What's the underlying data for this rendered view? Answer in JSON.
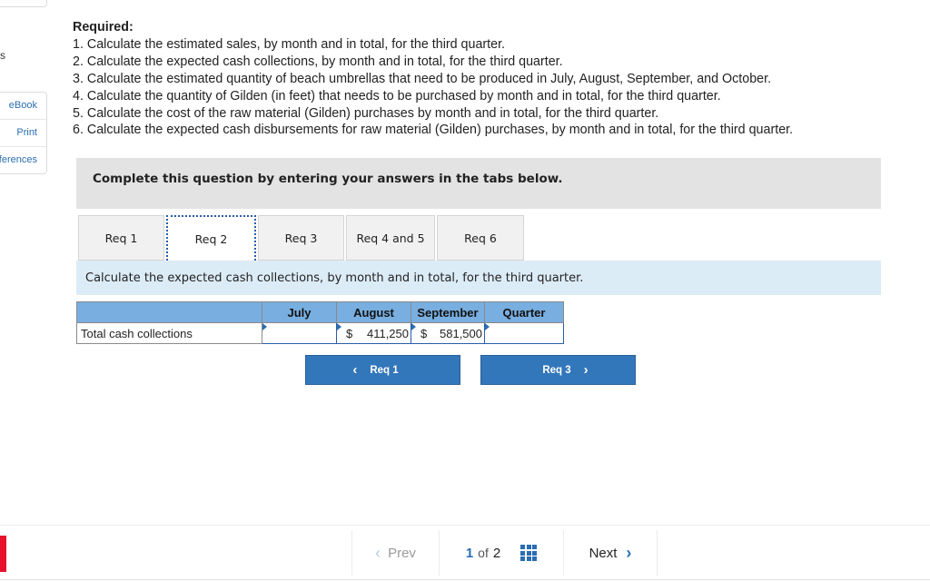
{
  "sidebar": {
    "fragment": "s",
    "items": [
      {
        "label": "eBook"
      },
      {
        "label": "Print"
      },
      {
        "label": "References"
      }
    ]
  },
  "required": {
    "title": "Required:",
    "items": [
      "1. Calculate the estimated sales, by month and in total, for the third quarter.",
      "2. Calculate the expected cash collections, by month and in total, for the third quarter.",
      "3. Calculate the estimated quantity of beach umbrellas that need to be produced in July, August, September, and October.",
      "4. Calculate the quantity of Gilden (in feet) that needs to be purchased by month and in total, for the third quarter.",
      "5. Calculate the cost of the raw material (Gilden) purchases by month and in total, for the third quarter.",
      "6. Calculate the expected cash disbursements for raw material (Gilden) purchases, by month and in total, for the third quarter."
    ]
  },
  "banner": {
    "text": "Complete this question by entering your answers in the tabs below."
  },
  "tabs": [
    {
      "label": "Req 1",
      "active": false
    },
    {
      "label": "Req 2",
      "active": true
    },
    {
      "label": "Req 3",
      "active": false
    },
    {
      "label": "Req 4 and 5",
      "active": false
    },
    {
      "label": "Req 6",
      "active": false
    }
  ],
  "instruction": "Calculate the expected cash collections, by month and in total, for the third quarter.",
  "table": {
    "columns": [
      "",
      "July",
      "August",
      "September",
      "Quarter"
    ],
    "rows": [
      {
        "label": "Total cash collections",
        "cells": [
          {
            "currency": "",
            "value": ""
          },
          {
            "currency": "$",
            "value": "411,250"
          },
          {
            "currency": "$",
            "value": "581,500"
          },
          {
            "currency": "",
            "value": ""
          }
        ]
      }
    ]
  },
  "nav": {
    "prev_label": "Req 1",
    "next_label": "Req 3",
    "prev_chevron": "‹",
    "next_chevron": "›"
  },
  "pager": {
    "prev_label": "Prev",
    "current": "1",
    "of_label": "of",
    "total": "2",
    "next_label": "Next",
    "prev_arrow": "‹",
    "next_arrow": "›"
  },
  "colors": {
    "accent": "#3377bb",
    "header_blue": "#78aee0",
    "instruction_bg": "#dcecf7",
    "brand_red": "#e8112d"
  }
}
